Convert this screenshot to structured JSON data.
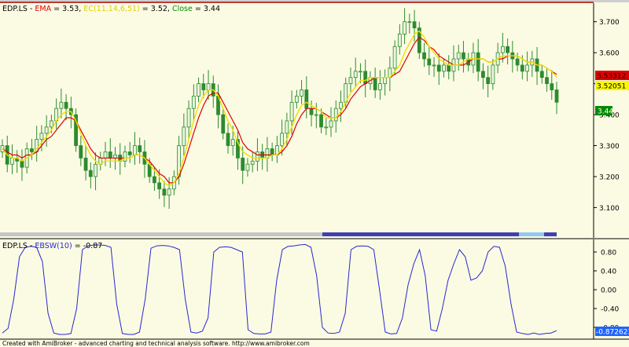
{
  "colors": {
    "background": "#fbfbe4",
    "up_candle": "#c8e6b4",
    "candle_outline": "#2e8b2e",
    "ema": "#e00000",
    "ec": "#f0e000",
    "ebsw": "#2828d0",
    "axis": "#000000",
    "grid": "#c8c8c8",
    "ema_box": "#e00000",
    "ec_box": "#f8f800",
    "close_box": "#008c00",
    "ebsw_box": "#1e64ff"
  },
  "price_panel": {
    "ticker": "EDP.LS",
    "ema_label": "EMA",
    "ema_value": "= 3.53,",
    "ec_label": "EC(11,14,6,51)",
    "ec_value": "= 3.52,",
    "close_label": "Close",
    "close_value": "= 3.44",
    "price_boxes": {
      "ema": "3.53312",
      "ec": "3.52051",
      "close": "3.44"
    }
  },
  "osc_panel": {
    "ticker": "EDP.LS",
    "label": "EBSW(10)",
    "value": "= -0.87",
    "value_box": "-0.872623"
  },
  "footer_text": "Created with AmiBroker - advanced charting and technical analysis software. http://www.amibroker.com",
  "chart_data": [
    {
      "type": "candlestick",
      "title": "EDP.LS",
      "y_ticks": [
        "3.700",
        "3.600",
        "3.500",
        "3.400",
        "3.300",
        "3.200",
        "3.100"
      ],
      "ylim": [
        3.02,
        3.76
      ],
      "grid": false,
      "series": [
        {
          "name": "EMA",
          "values": [
            3.29,
            3.28,
            3.27,
            3.27,
            3.26,
            3.27,
            3.27,
            3.28,
            3.3,
            3.32,
            3.33,
            3.35,
            3.37,
            3.39,
            3.39,
            3.38,
            3.35,
            3.32,
            3.29,
            3.27,
            3.26,
            3.26,
            3.26,
            3.26,
            3.26,
            3.26,
            3.26,
            3.27,
            3.27,
            3.26,
            3.25,
            3.23,
            3.21,
            3.2,
            3.18,
            3.18,
            3.2,
            3.24,
            3.29,
            3.34,
            3.39,
            3.43,
            3.46,
            3.47,
            3.47,
            3.44,
            3.41,
            3.38,
            3.35,
            3.31,
            3.29,
            3.28,
            3.27,
            3.27,
            3.27,
            3.27,
            3.27,
            3.28,
            3.3,
            3.33,
            3.37,
            3.4,
            3.42,
            3.42,
            3.42,
            3.41,
            3.4,
            3.39,
            3.39,
            3.4,
            3.42,
            3.45,
            3.47,
            3.49,
            3.5,
            3.51,
            3.52,
            3.52,
            3.52,
            3.52,
            3.53,
            3.54,
            3.57,
            3.6,
            3.63,
            3.65,
            3.64,
            3.62,
            3.61,
            3.59,
            3.58,
            3.57,
            3.56,
            3.56,
            3.56,
            3.57,
            3.58,
            3.58,
            3.58,
            3.57,
            3.57,
            3.58,
            3.58,
            3.59,
            3.59,
            3.59,
            3.58,
            3.57,
            3.57,
            3.56,
            3.56,
            3.55,
            3.54,
            3.53
          ]
        },
        {
          "name": "EC(11,14,6,51)",
          "values": [
            3.29,
            3.27,
            3.26,
            3.26,
            3.25,
            3.26,
            3.27,
            3.29,
            3.31,
            3.33,
            3.35,
            3.38,
            3.4,
            3.41,
            3.41,
            3.38,
            3.34,
            3.3,
            3.27,
            3.25,
            3.24,
            3.25,
            3.25,
            3.25,
            3.25,
            3.26,
            3.26,
            3.27,
            3.27,
            3.26,
            3.24,
            3.22,
            3.2,
            3.18,
            3.17,
            3.18,
            3.21,
            3.26,
            3.32,
            3.38,
            3.43,
            3.46,
            3.48,
            3.48,
            3.46,
            3.42,
            3.38,
            3.35,
            3.31,
            3.28,
            3.27,
            3.26,
            3.26,
            3.26,
            3.26,
            3.27,
            3.27,
            3.29,
            3.32,
            3.36,
            3.4,
            3.43,
            3.44,
            3.43,
            3.42,
            3.41,
            3.39,
            3.39,
            3.39,
            3.41,
            3.44,
            3.47,
            3.49,
            3.51,
            3.51,
            3.52,
            3.52,
            3.52,
            3.52,
            3.52,
            3.54,
            3.56,
            3.6,
            3.63,
            3.66,
            3.67,
            3.65,
            3.62,
            3.6,
            3.58,
            3.57,
            3.56,
            3.56,
            3.56,
            3.57,
            3.58,
            3.58,
            3.58,
            3.58,
            3.57,
            3.57,
            3.58,
            3.59,
            3.59,
            3.59,
            3.59,
            3.58,
            3.57,
            3.57,
            3.56,
            3.56,
            3.55,
            3.54,
            3.52
          ]
        },
        {
          "name": "Close",
          "values": [
            3.3,
            3.24,
            3.26,
            3.25,
            3.23,
            3.29,
            3.28,
            3.32,
            3.34,
            3.36,
            3.38,
            3.42,
            3.44,
            3.42,
            3.4,
            3.3,
            3.26,
            3.22,
            3.2,
            3.24,
            3.26,
            3.28,
            3.26,
            3.27,
            3.25,
            3.28,
            3.27,
            3.3,
            3.28,
            3.24,
            3.2,
            3.18,
            3.16,
            3.14,
            3.16,
            3.2,
            3.3,
            3.36,
            3.42,
            3.46,
            3.5,
            3.48,
            3.5,
            3.46,
            3.4,
            3.34,
            3.3,
            3.32,
            3.26,
            3.22,
            3.24,
            3.25,
            3.28,
            3.26,
            3.29,
            3.27,
            3.3,
            3.34,
            3.38,
            3.44,
            3.46,
            3.48,
            3.42,
            3.4,
            3.4,
            3.36,
            3.36,
            3.38,
            3.42,
            3.44,
            3.5,
            3.52,
            3.54,
            3.54,
            3.5,
            3.52,
            3.48,
            3.5,
            3.52,
            3.55,
            3.62,
            3.66,
            3.7,
            3.7,
            3.68,
            3.6,
            3.58,
            3.56,
            3.56,
            3.54,
            3.56,
            3.54,
            3.58,
            3.6,
            3.58,
            3.56,
            3.6,
            3.54,
            3.52,
            3.5,
            3.56,
            3.6,
            3.62,
            3.6,
            3.58,
            3.56,
            3.54,
            3.56,
            3.58,
            3.54,
            3.52,
            3.5,
            3.48,
            3.44
          ]
        }
      ]
    },
    {
      "type": "line",
      "title": "EBSW(10)",
      "y_ticks": [
        "0.80",
        "0.40",
        "0.00",
        "-0.40",
        "-0.80"
      ],
      "ylim": [
        -1.0,
        1.0
      ],
      "grid": false,
      "series": [
        {
          "name": "EBSW(10)",
          "values": [
            -0.92,
            -0.82,
            -0.2,
            0.7,
            0.9,
            0.92,
            0.9,
            0.6,
            -0.5,
            -0.92,
            -0.95,
            -0.95,
            -0.93,
            -0.4,
            0.85,
            0.93,
            0.95,
            0.95,
            0.94,
            0.9,
            -0.3,
            -0.93,
            -0.95,
            -0.95,
            -0.9,
            -0.2,
            0.88,
            0.93,
            0.94,
            0.93,
            0.9,
            0.85,
            -0.2,
            -0.9,
            -0.92,
            -0.88,
            -0.6,
            0.8,
            0.9,
            0.91,
            0.9,
            0.85,
            0.8,
            -0.85,
            -0.93,
            -0.94,
            -0.94,
            -0.9,
            0.2,
            0.85,
            0.92,
            0.93,
            0.95,
            0.96,
            0.9,
            0.3,
            -0.8,
            -0.92,
            -0.93,
            -0.9,
            -0.5,
            0.85,
            0.92,
            0.93,
            0.92,
            0.85,
            0.0,
            -0.9,
            -0.94,
            -0.93,
            -0.6,
            0.1,
            0.55,
            0.85,
            0.3,
            -0.85,
            -0.88,
            -0.4,
            0.2,
            0.55,
            0.85,
            0.7,
            0.2,
            0.25,
            0.4,
            0.8,
            0.92,
            0.9,
            0.5,
            -0.3,
            -0.9,
            -0.93,
            -0.95,
            -0.92,
            -0.95,
            -0.93,
            -0.92,
            -0.87
          ]
        }
      ]
    }
  ]
}
